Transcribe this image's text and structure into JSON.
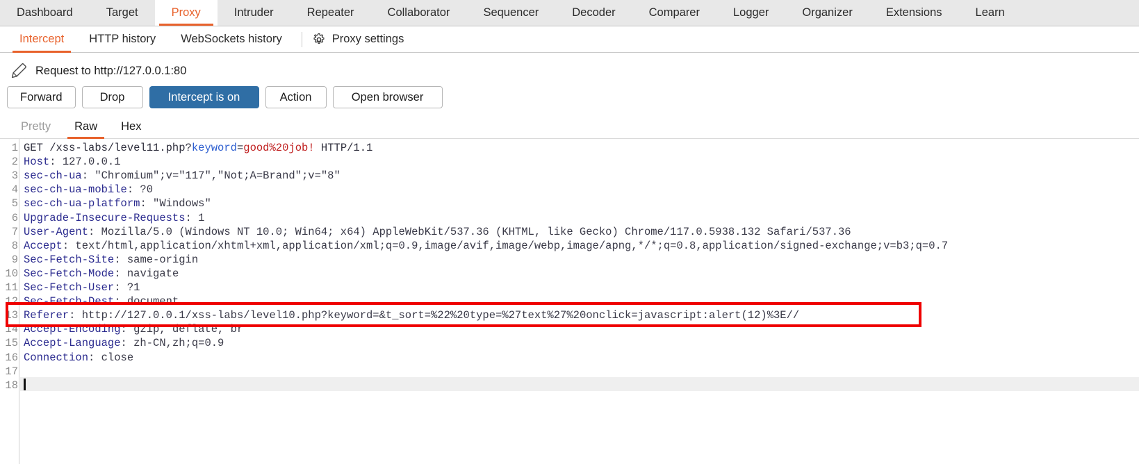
{
  "main_tabs": [
    {
      "label": "Dashboard",
      "active": false
    },
    {
      "label": "Target",
      "active": false
    },
    {
      "label": "Proxy",
      "active": true
    },
    {
      "label": "Intruder",
      "active": false
    },
    {
      "label": "Repeater",
      "active": false
    },
    {
      "label": "Collaborator",
      "active": false
    },
    {
      "label": "Sequencer",
      "active": false
    },
    {
      "label": "Decoder",
      "active": false
    },
    {
      "label": "Comparer",
      "active": false
    },
    {
      "label": "Logger",
      "active": false
    },
    {
      "label": "Organizer",
      "active": false
    },
    {
      "label": "Extensions",
      "active": false
    },
    {
      "label": "Learn",
      "active": false
    }
  ],
  "sub_tabs": [
    {
      "label": "Intercept",
      "active": true
    },
    {
      "label": "HTTP history",
      "active": false
    },
    {
      "label": "WebSockets history",
      "active": false
    }
  ],
  "proxy_settings": {
    "label": "Proxy settings",
    "icon": "gear-icon"
  },
  "banner": {
    "icon": "pencil-icon",
    "text": "Request to http://127.0.0.1:80"
  },
  "buttons": [
    {
      "label": "Forward",
      "style": "default",
      "name": "forward-button"
    },
    {
      "label": "Drop",
      "style": "default",
      "name": "drop-button"
    },
    {
      "label": "Intercept is on",
      "style": "primary",
      "name": "intercept-toggle-button"
    },
    {
      "label": "Action",
      "style": "default",
      "name": "action-button"
    },
    {
      "label": "Open browser",
      "style": "default",
      "name": "open-browser-button"
    }
  ],
  "view_tabs": [
    {
      "label": "Pretty",
      "active": false,
      "muted": true
    },
    {
      "label": "Raw",
      "active": true,
      "muted": false
    },
    {
      "label": "Hex",
      "active": false,
      "muted": false
    }
  ],
  "editor": {
    "line_numbers": [
      "1",
      "2",
      "3",
      "4",
      "5",
      "6",
      "7",
      "8",
      "9",
      "10",
      "11",
      "12",
      "13",
      "14",
      "15",
      "16",
      "17",
      "18"
    ],
    "lines": [
      {
        "n": 1,
        "segments": [
          {
            "t": "GET /xss-labs/level11.php?",
            "c": "plain"
          },
          {
            "t": "keyword",
            "c": "pblue"
          },
          {
            "t": "=",
            "c": "plain"
          },
          {
            "t": "good%20job!",
            "c": "pred"
          },
          {
            "t": " HTTP/1.1",
            "c": "plain"
          }
        ]
      },
      {
        "n": 2,
        "segments": [
          {
            "t": "Host",
            "c": "hdr"
          },
          {
            "t": ": 127.0.0.1",
            "c": "val"
          }
        ]
      },
      {
        "n": 3,
        "segments": [
          {
            "t": "sec-ch-ua",
            "c": "hdr"
          },
          {
            "t": ": \"Chromium\";v=\"117\",\"Not;A=Brand\";v=\"8\"",
            "c": "val"
          }
        ]
      },
      {
        "n": 4,
        "segments": [
          {
            "t": "sec-ch-ua-mobile",
            "c": "hdr"
          },
          {
            "t": ": ?0",
            "c": "val"
          }
        ]
      },
      {
        "n": 5,
        "segments": [
          {
            "t": "sec-ch-ua-platform",
            "c": "hdr"
          },
          {
            "t": ": \"Windows\"",
            "c": "val"
          }
        ]
      },
      {
        "n": 6,
        "segments": [
          {
            "t": "Upgrade-Insecure-Requests",
            "c": "hdr"
          },
          {
            "t": ": 1",
            "c": "val"
          }
        ]
      },
      {
        "n": 7,
        "segments": [
          {
            "t": "User-Agent",
            "c": "hdr"
          },
          {
            "t": ": Mozilla/5.0 (Windows NT 10.0; Win64; x64) AppleWebKit/537.36 (KHTML, like Gecko) Chrome/117.0.5938.132 Safari/537.36",
            "c": "val"
          }
        ]
      },
      {
        "n": 8,
        "segments": [
          {
            "t": "Accept",
            "c": "hdr"
          },
          {
            "t": ": text/html,application/xhtml+xml,application/xml;q=0.9,image/avif,image/webp,image/apng,*/*;q=0.8,application/signed-exchange;v=b3;q=0.7",
            "c": "val"
          }
        ]
      },
      {
        "n": 9,
        "segments": [
          {
            "t": "Sec-Fetch-Site",
            "c": "hdr"
          },
          {
            "t": ": same-origin",
            "c": "val"
          }
        ]
      },
      {
        "n": 10,
        "segments": [
          {
            "t": "Sec-Fetch-Mode",
            "c": "hdr"
          },
          {
            "t": ": navigate",
            "c": "val"
          }
        ]
      },
      {
        "n": 11,
        "segments": [
          {
            "t": "Sec-Fetch-User",
            "c": "hdr"
          },
          {
            "t": ": ?1",
            "c": "val"
          }
        ]
      },
      {
        "n": 12,
        "segments": [
          {
            "t": "Sec-Fetch-Dest",
            "c": "hdr"
          },
          {
            "t": ": document",
            "c": "val"
          }
        ]
      },
      {
        "n": 13,
        "segments": [
          {
            "t": "Referer",
            "c": "hdr"
          },
          {
            "t": ": http://127.0.0.1/xss-labs/level10.php?keyword=&t_sort=%22%20type=%27text%27%20onclick=javascript:alert(12)%3E//",
            "c": "val"
          }
        ]
      },
      {
        "n": 14,
        "segments": [
          {
            "t": "Accept-Encoding",
            "c": "hdr"
          },
          {
            "t": ": gzip, deflate, br",
            "c": "val"
          }
        ]
      },
      {
        "n": 15,
        "segments": [
          {
            "t": "Accept-Language",
            "c": "hdr"
          },
          {
            "t": ": zh-CN,zh;q=0.9",
            "c": "val"
          }
        ]
      },
      {
        "n": 16,
        "segments": [
          {
            "t": "Connection",
            "c": "hdr"
          },
          {
            "t": ": close",
            "c": "val"
          }
        ]
      },
      {
        "n": 17,
        "segments": [
          {
            "t": "",
            "c": "plain"
          }
        ]
      },
      {
        "n": 18,
        "segments": [
          {
            "t": "",
            "c": "plain"
          }
        ]
      }
    ],
    "cursor_line": 18,
    "highlight": {
      "target_line": 13,
      "color": "#ef0000"
    }
  },
  "colors": {
    "accent": "#e8622c",
    "primary_button": "#2f6ea5",
    "header_token": "#2b2b8f",
    "param_name": "#2e5fd0",
    "param_value": "#c02020",
    "highlight_box": "#ef0000"
  }
}
